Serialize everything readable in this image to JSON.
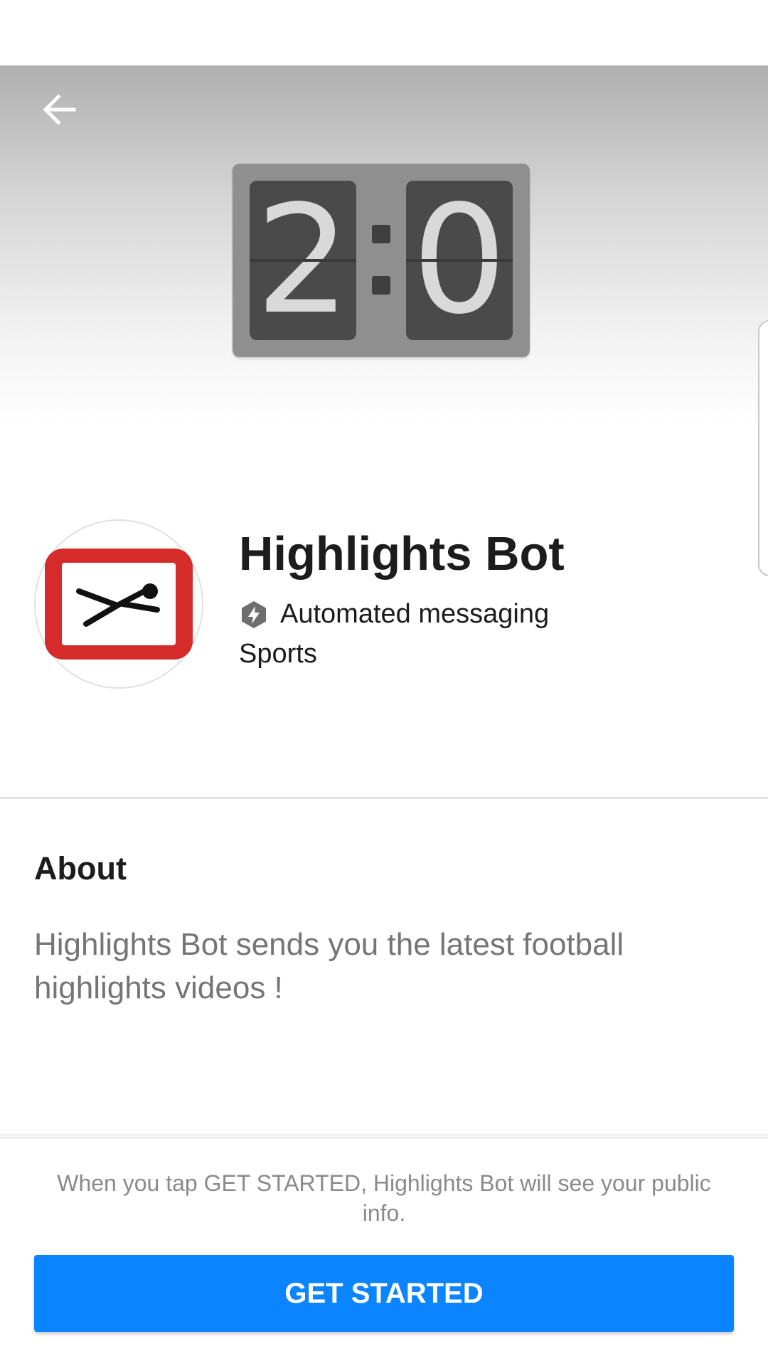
{
  "header": {
    "back_icon": "arrow-left-icon"
  },
  "cover": {
    "score_left": "2",
    "score_right": "0"
  },
  "profile": {
    "name": "Highlights Bot",
    "badge_icon": "lightning-hexagon-icon",
    "badge_label": "Automated messaging",
    "category": "Sports",
    "avatar_icon": "tv-diving-player-icon"
  },
  "about": {
    "heading": "About",
    "description": "Highlights Bot sends you the latest football highlights videos !"
  },
  "footer": {
    "disclaimer": "When you tap GET STARTED, Highlights Bot will see your public info.",
    "cta_label": "GET STARTED"
  },
  "colors": {
    "primary_button": "#0a84ff",
    "avatar_red": "#d62b2b"
  }
}
